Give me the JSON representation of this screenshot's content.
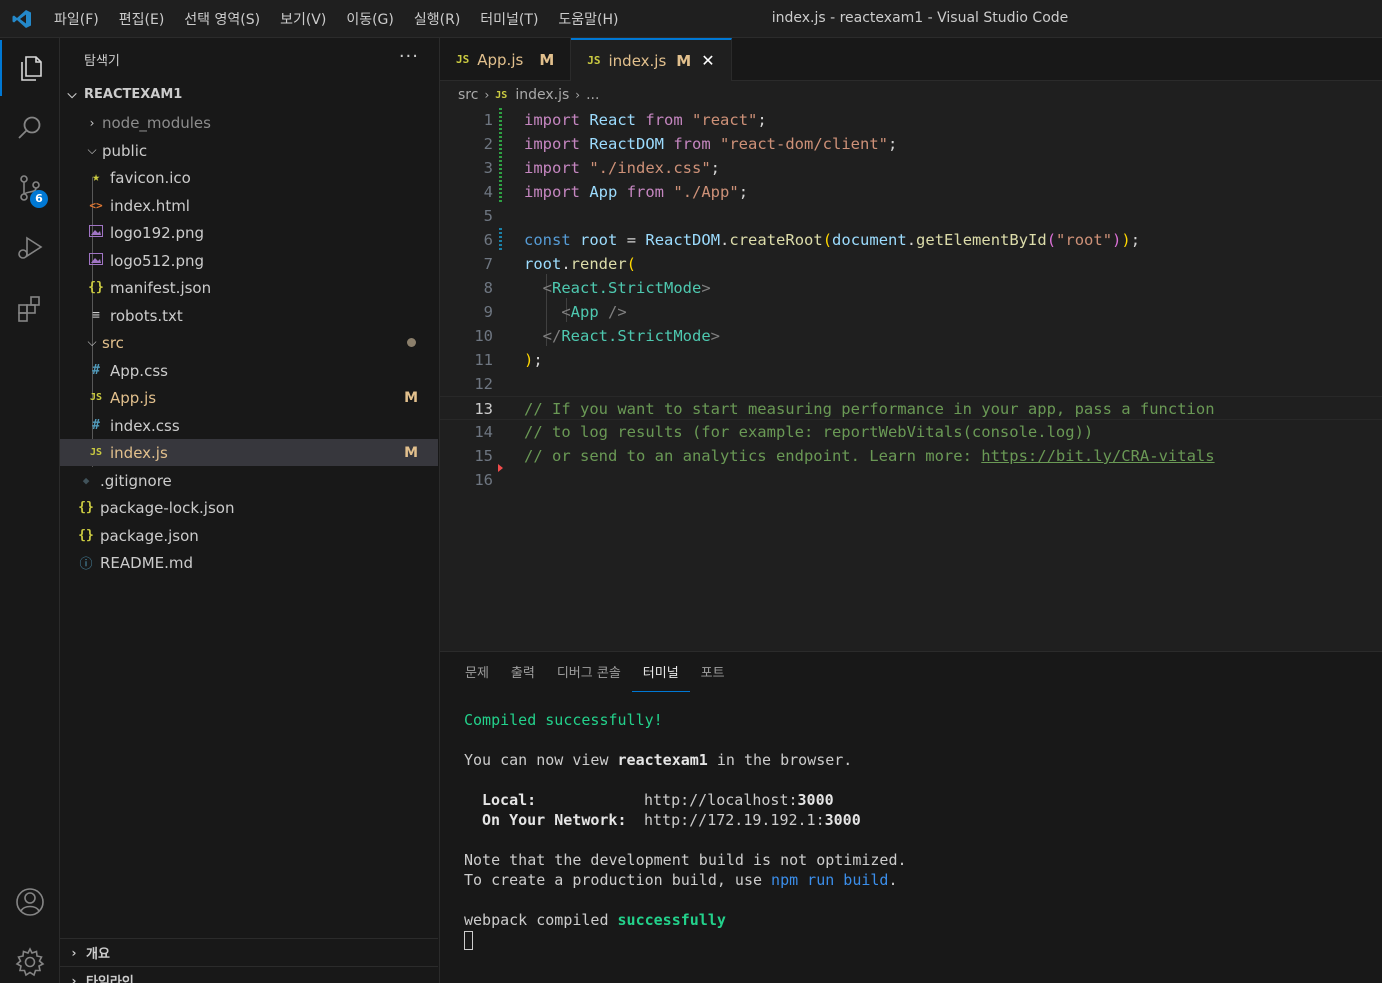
{
  "window": {
    "title": "index.js - reactexam1 - Visual Studio Code",
    "menu": [
      "파일(F)",
      "편집(E)",
      "선택 영역(S)",
      "보기(V)",
      "이동(G)",
      "실행(R)",
      "터미널(T)",
      "도움말(H)"
    ]
  },
  "activity_bar": {
    "source_control_badge": "6"
  },
  "sidebar": {
    "title": "탐색기",
    "more": "···",
    "root": "REACTEXAM1",
    "items": [
      {
        "label": "node_modules",
        "icon": "chevron-right"
      },
      {
        "label": "public",
        "icon": "chevron-down"
      },
      {
        "label": "favicon.ico",
        "icon": "★"
      },
      {
        "label": "index.html",
        "icon": "<>"
      },
      {
        "label": "logo192.png",
        "icon": "image"
      },
      {
        "label": "logo512.png",
        "icon": "image"
      },
      {
        "label": "manifest.json",
        "icon": "{}"
      },
      {
        "label": "robots.txt",
        "icon": "≡"
      },
      {
        "label": "src",
        "icon": "chevron-down"
      },
      {
        "label": "App.css",
        "icon": "#"
      },
      {
        "label": "App.js",
        "icon": "JS",
        "status": "M"
      },
      {
        "label": "index.css",
        "icon": "#"
      },
      {
        "label": "index.js",
        "icon": "JS",
        "status": "M"
      },
      {
        "label": ".gitignore",
        "icon": "◆"
      },
      {
        "label": "package-lock.json",
        "icon": "{}"
      },
      {
        "label": "package.json",
        "icon": "{}"
      },
      {
        "label": "README.md",
        "icon": "ⓘ"
      }
    ],
    "sections": [
      "개요",
      "타임라인"
    ]
  },
  "tabs": [
    {
      "file_icon": "JS",
      "label": "App.js",
      "status": "M"
    },
    {
      "file_icon": "JS",
      "label": "index.js",
      "status": "M",
      "close": "✕"
    }
  ],
  "breadcrumb": {
    "folder": "src",
    "file_icon": "JS",
    "file": "index.js",
    "tail": "..."
  },
  "editor": {
    "current_line": 13,
    "lines": [
      "import React from \"react\";",
      "import ReactDOM from \"react-dom/client\";",
      "import \"./index.css\";",
      "import App from \"./App\";",
      "",
      "const root = ReactDOM.createRoot(document.getElementById(\"root\"));",
      "root.render(",
      "  <React.StrictMode>",
      "    <App />",
      "  </React.StrictMode>",
      ");",
      "",
      "// If you want to start measuring performance in your app, pass a function",
      "// to log results (for example: reportWebVitals(console.log))",
      "// or send to an analytics endpoint. Learn more: https://bit.ly/CRA-vitals",
      ""
    ]
  },
  "panel": {
    "tabs": [
      "문제",
      "출력",
      "디버그 콘솔",
      "터미널",
      "포트"
    ],
    "active_tab": "터미널",
    "terminal": {
      "compiled": "Compiled successfully!",
      "view_prefix": "You can now view ",
      "app_name": "reactexam1",
      "view_suffix": " in the browser.",
      "local_label": "Local:",
      "local_url_prefix": "http://localhost:",
      "local_port": "3000",
      "network_label": "On Your Network:",
      "network_url_prefix": "http://172.19.192.1:",
      "network_port": "3000",
      "note": "Note that the development build is not optimized.",
      "build_prefix": "To create a production build, use ",
      "build_cmd": "npm run build",
      "build_suffix": ".",
      "webpack_prefix": "webpack compiled ",
      "webpack_status": "successfully"
    }
  },
  "colors": {
    "accent": "#0078d4",
    "modified": "#e2c08d",
    "success": "#23d18b"
  }
}
